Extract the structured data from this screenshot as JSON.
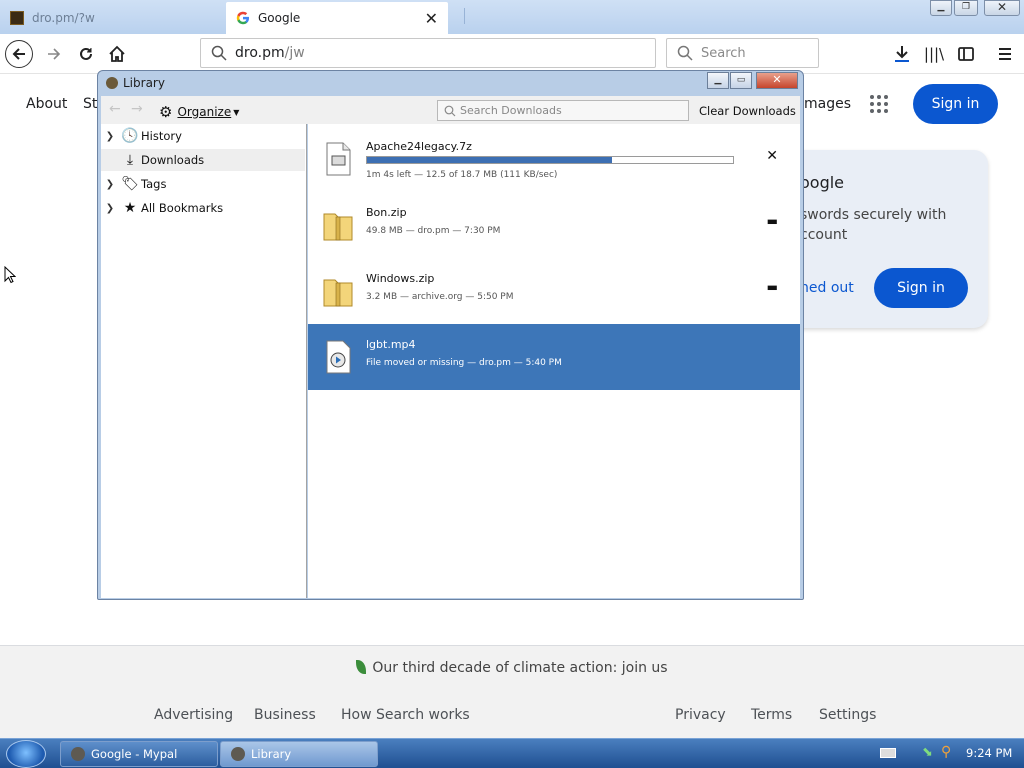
{
  "browser": {
    "tabs": [
      {
        "label": "dro.pm/?w"
      },
      {
        "label": "Google"
      }
    ],
    "url_host": "dro.pm",
    "url_path": "/jw",
    "search_placeholder": "Search"
  },
  "google": {
    "top_links": [
      "About",
      "St",
      "mages"
    ],
    "sign_in": "Sign in",
    "card": {
      "title": "oogle",
      "text": "swords securely with ccount",
      "link": "ned out",
      "button": "Sign in"
    },
    "climate": "Our third decade of climate action: join us",
    "footer_left": [
      "Advertising",
      "Business",
      "How Search works"
    ],
    "footer_right": [
      "Privacy",
      "Terms",
      "Settings"
    ]
  },
  "library": {
    "title": "Library",
    "organize": "Organize",
    "search_placeholder": "Search Downloads",
    "clear": "Clear Downloads",
    "sidebar": [
      {
        "label": "History",
        "icon": "clock-icon"
      },
      {
        "label": "Downloads",
        "icon": "download-icon"
      },
      {
        "label": "Tags",
        "icon": "tag-icon"
      },
      {
        "label": "All Bookmarks",
        "icon": "star-icon"
      }
    ],
    "downloads": [
      {
        "name": "Apache24legacy.7z",
        "meta": "1m 4s left — 12.5 of 18.7 MB (111 KB/sec)",
        "progress": 0.67
      },
      {
        "name": "Bon.zip",
        "meta": "49.8 MB — dro.pm — 7:30 PM"
      },
      {
        "name": "Windows.zip",
        "meta": "3.2 MB — archive.org — 5:50 PM"
      },
      {
        "name": "lgbt.mp4",
        "meta": "File moved or missing — dro.pm — 5:40 PM"
      }
    ]
  },
  "taskbar": {
    "items": [
      {
        "label": "Google - Mypal"
      },
      {
        "label": "Library"
      }
    ],
    "clock": "9:24 PM"
  },
  "colors": {
    "accent": "#0b57d0",
    "selection": "#3d76b8",
    "progress": "#3d6fb3"
  }
}
